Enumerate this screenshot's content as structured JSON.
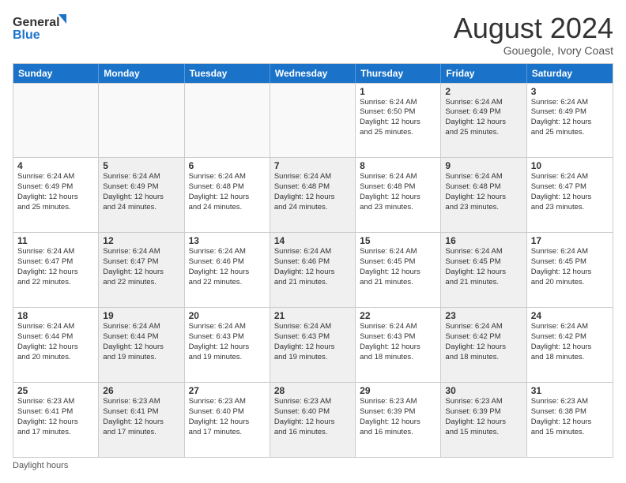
{
  "logo": {
    "line1": "General",
    "line2": "Blue"
  },
  "title": "August 2024",
  "location": "Gouegole, Ivory Coast",
  "days_of_week": [
    "Sunday",
    "Monday",
    "Tuesday",
    "Wednesday",
    "Thursday",
    "Friday",
    "Saturday"
  ],
  "footer": "Daylight hours",
  "weeks": [
    [
      {
        "day": "",
        "lines": [],
        "empty": true
      },
      {
        "day": "",
        "lines": [],
        "empty": true
      },
      {
        "day": "",
        "lines": [],
        "empty": true
      },
      {
        "day": "",
        "lines": [],
        "empty": true
      },
      {
        "day": "1",
        "lines": [
          "Sunrise: 6:24 AM",
          "Sunset: 6:50 PM",
          "Daylight: 12 hours",
          "and 25 minutes."
        ],
        "empty": false,
        "shaded": false
      },
      {
        "day": "2",
        "lines": [
          "Sunrise: 6:24 AM",
          "Sunset: 6:49 PM",
          "Daylight: 12 hours",
          "and 25 minutes."
        ],
        "empty": false,
        "shaded": true
      },
      {
        "day": "3",
        "lines": [
          "Sunrise: 6:24 AM",
          "Sunset: 6:49 PM",
          "Daylight: 12 hours",
          "and 25 minutes."
        ],
        "empty": false,
        "shaded": false
      }
    ],
    [
      {
        "day": "4",
        "lines": [
          "Sunrise: 6:24 AM",
          "Sunset: 6:49 PM",
          "Daylight: 12 hours",
          "and 25 minutes."
        ],
        "empty": false,
        "shaded": false
      },
      {
        "day": "5",
        "lines": [
          "Sunrise: 6:24 AM",
          "Sunset: 6:49 PM",
          "Daylight: 12 hours",
          "and 24 minutes."
        ],
        "empty": false,
        "shaded": true
      },
      {
        "day": "6",
        "lines": [
          "Sunrise: 6:24 AM",
          "Sunset: 6:48 PM",
          "Daylight: 12 hours",
          "and 24 minutes."
        ],
        "empty": false,
        "shaded": false
      },
      {
        "day": "7",
        "lines": [
          "Sunrise: 6:24 AM",
          "Sunset: 6:48 PM",
          "Daylight: 12 hours",
          "and 24 minutes."
        ],
        "empty": false,
        "shaded": true
      },
      {
        "day": "8",
        "lines": [
          "Sunrise: 6:24 AM",
          "Sunset: 6:48 PM",
          "Daylight: 12 hours",
          "and 23 minutes."
        ],
        "empty": false,
        "shaded": false
      },
      {
        "day": "9",
        "lines": [
          "Sunrise: 6:24 AM",
          "Sunset: 6:48 PM",
          "Daylight: 12 hours",
          "and 23 minutes."
        ],
        "empty": false,
        "shaded": true
      },
      {
        "day": "10",
        "lines": [
          "Sunrise: 6:24 AM",
          "Sunset: 6:47 PM",
          "Daylight: 12 hours",
          "and 23 minutes."
        ],
        "empty": false,
        "shaded": false
      }
    ],
    [
      {
        "day": "11",
        "lines": [
          "Sunrise: 6:24 AM",
          "Sunset: 6:47 PM",
          "Daylight: 12 hours",
          "and 22 minutes."
        ],
        "empty": false,
        "shaded": false
      },
      {
        "day": "12",
        "lines": [
          "Sunrise: 6:24 AM",
          "Sunset: 6:47 PM",
          "Daylight: 12 hours",
          "and 22 minutes."
        ],
        "empty": false,
        "shaded": true
      },
      {
        "day": "13",
        "lines": [
          "Sunrise: 6:24 AM",
          "Sunset: 6:46 PM",
          "Daylight: 12 hours",
          "and 22 minutes."
        ],
        "empty": false,
        "shaded": false
      },
      {
        "day": "14",
        "lines": [
          "Sunrise: 6:24 AM",
          "Sunset: 6:46 PM",
          "Daylight: 12 hours",
          "and 21 minutes."
        ],
        "empty": false,
        "shaded": true
      },
      {
        "day": "15",
        "lines": [
          "Sunrise: 6:24 AM",
          "Sunset: 6:45 PM",
          "Daylight: 12 hours",
          "and 21 minutes."
        ],
        "empty": false,
        "shaded": false
      },
      {
        "day": "16",
        "lines": [
          "Sunrise: 6:24 AM",
          "Sunset: 6:45 PM",
          "Daylight: 12 hours",
          "and 21 minutes."
        ],
        "empty": false,
        "shaded": true
      },
      {
        "day": "17",
        "lines": [
          "Sunrise: 6:24 AM",
          "Sunset: 6:45 PM",
          "Daylight: 12 hours",
          "and 20 minutes."
        ],
        "empty": false,
        "shaded": false
      }
    ],
    [
      {
        "day": "18",
        "lines": [
          "Sunrise: 6:24 AM",
          "Sunset: 6:44 PM",
          "Daylight: 12 hours",
          "and 20 minutes."
        ],
        "empty": false,
        "shaded": false
      },
      {
        "day": "19",
        "lines": [
          "Sunrise: 6:24 AM",
          "Sunset: 6:44 PM",
          "Daylight: 12 hours",
          "and 19 minutes."
        ],
        "empty": false,
        "shaded": true
      },
      {
        "day": "20",
        "lines": [
          "Sunrise: 6:24 AM",
          "Sunset: 6:43 PM",
          "Daylight: 12 hours",
          "and 19 minutes."
        ],
        "empty": false,
        "shaded": false
      },
      {
        "day": "21",
        "lines": [
          "Sunrise: 6:24 AM",
          "Sunset: 6:43 PM",
          "Daylight: 12 hours",
          "and 19 minutes."
        ],
        "empty": false,
        "shaded": true
      },
      {
        "day": "22",
        "lines": [
          "Sunrise: 6:24 AM",
          "Sunset: 6:43 PM",
          "Daylight: 12 hours",
          "and 18 minutes."
        ],
        "empty": false,
        "shaded": false
      },
      {
        "day": "23",
        "lines": [
          "Sunrise: 6:24 AM",
          "Sunset: 6:42 PM",
          "Daylight: 12 hours",
          "and 18 minutes."
        ],
        "empty": false,
        "shaded": true
      },
      {
        "day": "24",
        "lines": [
          "Sunrise: 6:24 AM",
          "Sunset: 6:42 PM",
          "Daylight: 12 hours",
          "and 18 minutes."
        ],
        "empty": false,
        "shaded": false
      }
    ],
    [
      {
        "day": "25",
        "lines": [
          "Sunrise: 6:23 AM",
          "Sunset: 6:41 PM",
          "Daylight: 12 hours",
          "and 17 minutes."
        ],
        "empty": false,
        "shaded": false
      },
      {
        "day": "26",
        "lines": [
          "Sunrise: 6:23 AM",
          "Sunset: 6:41 PM",
          "Daylight: 12 hours",
          "and 17 minutes."
        ],
        "empty": false,
        "shaded": true
      },
      {
        "day": "27",
        "lines": [
          "Sunrise: 6:23 AM",
          "Sunset: 6:40 PM",
          "Daylight: 12 hours",
          "and 17 minutes."
        ],
        "empty": false,
        "shaded": false
      },
      {
        "day": "28",
        "lines": [
          "Sunrise: 6:23 AM",
          "Sunset: 6:40 PM",
          "Daylight: 12 hours",
          "and 16 minutes."
        ],
        "empty": false,
        "shaded": true
      },
      {
        "day": "29",
        "lines": [
          "Sunrise: 6:23 AM",
          "Sunset: 6:39 PM",
          "Daylight: 12 hours",
          "and 16 minutes."
        ],
        "empty": false,
        "shaded": false
      },
      {
        "day": "30",
        "lines": [
          "Sunrise: 6:23 AM",
          "Sunset: 6:39 PM",
          "Daylight: 12 hours",
          "and 15 minutes."
        ],
        "empty": false,
        "shaded": true
      },
      {
        "day": "31",
        "lines": [
          "Sunrise: 6:23 AM",
          "Sunset: 6:38 PM",
          "Daylight: 12 hours",
          "and 15 minutes."
        ],
        "empty": false,
        "shaded": false
      }
    ]
  ]
}
